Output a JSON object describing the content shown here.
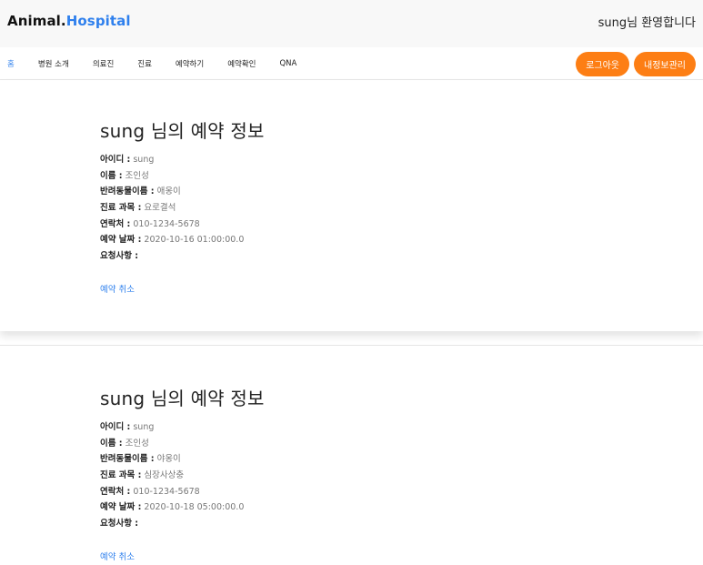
{
  "header": {
    "logo_main": "Animal.",
    "logo_accent": "Hospital",
    "welcome": "sung님 환영합니다"
  },
  "nav": {
    "items": [
      "홈",
      "병원 소개",
      "의료진",
      "진료",
      "예약하기",
      "예약확인",
      "QNA"
    ],
    "logout": "로그아웃",
    "my_info": "내정보관리"
  },
  "reservations": [
    {
      "title": "sung 님의 예약 정보",
      "fields": [
        {
          "label": "아이디 :",
          "value": "sung"
        },
        {
          "label": "이름 :",
          "value": "조인성"
        },
        {
          "label": "반려동물이름 :",
          "value": "애옹이"
        },
        {
          "label": "진료 과목 :",
          "value": "요로결석"
        },
        {
          "label": "연락처 :",
          "value": "010-1234-5678"
        },
        {
          "label": "예약 날짜 :",
          "value": "2020-10-16 01:00:00.0"
        },
        {
          "label": "요청사항 :",
          "value": ""
        }
      ],
      "cancel": "예약 취소"
    },
    {
      "title": "sung 님의 예약 정보",
      "fields": [
        {
          "label": "아이디 :",
          "value": "sung"
        },
        {
          "label": "이름 :",
          "value": "조인성"
        },
        {
          "label": "반려동물이름 :",
          "value": "야옹이"
        },
        {
          "label": "진료 과목 :",
          "value": "심장사상충"
        },
        {
          "label": "연락처 :",
          "value": "010-1234-5678"
        },
        {
          "label": "예약 날짜 :",
          "value": "2020-10-18 05:00:00.0"
        },
        {
          "label": "요청사항 :",
          "value": ""
        }
      ],
      "cancel": "예약 취소"
    }
  ]
}
